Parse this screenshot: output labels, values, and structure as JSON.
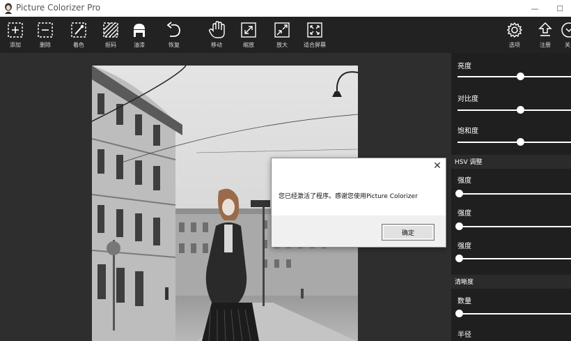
{
  "window": {
    "title": "Picture Colorizer Pro",
    "minimize": "—",
    "maximize": "☐"
  },
  "toolbar": {
    "left_tools": [
      {
        "label": "添加",
        "icon": "add-icon"
      },
      {
        "label": "删除",
        "icon": "remove-icon"
      },
      {
        "label": "着色",
        "icon": "colorize-icon"
      },
      {
        "label": "抠码",
        "icon": "hatch-icon"
      },
      {
        "label": "油漆",
        "icon": "paint-bucket-icon"
      },
      {
        "label": "恢复",
        "icon": "undo-icon"
      },
      {
        "label": "移动",
        "icon": "hand-icon"
      },
      {
        "label": "缩放",
        "icon": "expand-icon"
      },
      {
        "label": "放大",
        "icon": "zoom-in-icon"
      },
      {
        "label": "适合屏幕",
        "icon": "fit-screen-icon"
      }
    ],
    "right_tools": [
      {
        "label": "选项",
        "icon": "gear-icon"
      },
      {
        "label": "注册",
        "icon": "upload-icon"
      },
      {
        "label": "关",
        "icon": "power-icon"
      }
    ]
  },
  "panel": {
    "basic": {
      "sliders": [
        {
          "label": "亮度",
          "value": 0.55
        },
        {
          "label": "对比度",
          "value": 0.55
        },
        {
          "label": "饱和度",
          "value": 0.55
        }
      ]
    },
    "hsv": {
      "header": "HSV 调整",
      "sliders": [
        {
          "label": "强度",
          "value": 0.0
        },
        {
          "label": "强度",
          "value": 0.0
        },
        {
          "label": "强度",
          "value": 0.0
        }
      ]
    },
    "sharpness": {
      "header": "清晰度",
      "sliders": [
        {
          "label": "数量",
          "value": 0.0
        },
        {
          "label": "半径",
          "value": 0.0
        }
      ]
    }
  },
  "dialog": {
    "close": "✕",
    "message": "您已经激活了程序。感谢您使用Picture Colorizer",
    "ok": "确定"
  },
  "photo": {
    "sign_text": "..."
  },
  "colors": {
    "titlebar_bg": "#ffffff",
    "toolbar_bg": "#222222",
    "canvas_bg": "#2e2e2e",
    "panel_bg": "#1f1f1f",
    "panel_header_bg": "#2b2b2b"
  }
}
